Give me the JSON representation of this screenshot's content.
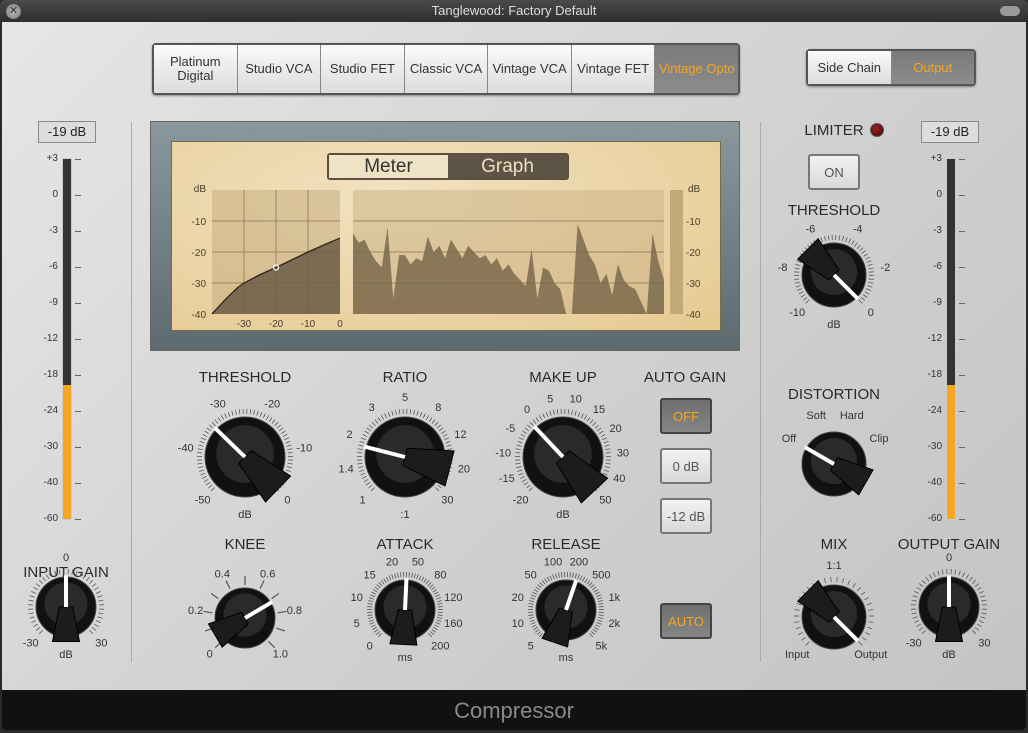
{
  "window": {
    "title": "Tanglewood: Factory Default",
    "close_icon": "close-icon",
    "footer_title": "Compressor"
  },
  "models": {
    "items": [
      {
        "label": "Platinum Digital"
      },
      {
        "label": "Studio VCA"
      },
      {
        "label": "Studio FET"
      },
      {
        "label": "Classic VCA"
      },
      {
        "label": "Vintage VCA"
      },
      {
        "label": "Vintage FET"
      },
      {
        "label": "Vintage Opto",
        "selected": true
      }
    ]
  },
  "routing": {
    "items": [
      {
        "label": "Side Chain"
      },
      {
        "label": "Output",
        "selected": true
      }
    ]
  },
  "colors": {
    "accent": "#f5a623",
    "meter_fill": "#f5a623",
    "display_bg": "#e9d3a3"
  },
  "input_meter": {
    "reading": "-19 dB",
    "scale": [
      "+3",
      "0",
      "-3",
      "-6",
      "-9",
      "-12",
      "-18",
      "-24",
      "-30",
      "-40",
      "-60"
    ],
    "level_fraction": 0.37
  },
  "output_meter": {
    "reading": "-19 dB",
    "scale": [
      "+3",
      "0",
      "-3",
      "-6",
      "-9",
      "-12",
      "-18",
      "-24",
      "-30",
      "-40",
      "-60"
    ],
    "level_fraction": 0.37
  },
  "display": {
    "tabs": [
      {
        "label": "Meter"
      },
      {
        "label": "Graph",
        "selected": true
      }
    ],
    "left_unit": "dB",
    "right_unit": "dB",
    "y_ticks": [
      "-10",
      "-20",
      "-30",
      "-40"
    ],
    "x_ticks": [
      "-40",
      "-30",
      "-20",
      "-10",
      "0"
    ],
    "right_ticks": [
      "-10",
      "-20",
      "-30",
      "-40"
    ]
  },
  "chart_data": [
    {
      "type": "line",
      "title": "",
      "xlabel": "",
      "ylabel": "dB",
      "xlim": [
        -40,
        0
      ],
      "ylim": [
        -40,
        0
      ],
      "x": [
        -40,
        -36,
        -32,
        -30,
        -25,
        -20,
        -15,
        -10,
        -5,
        0
      ],
      "y": [
        -40,
        -35.5,
        -31.5,
        -30,
        -27.3,
        -25,
        -22.5,
        -20,
        -17.7,
        -15.5
      ],
      "marker": {
        "x": -20,
        "y": -25
      },
      "grid": true
    },
    {
      "type": "area",
      "title": "",
      "ylabel": "dB",
      "ylim": [
        -40,
        0
      ],
      "grid": true,
      "values": [
        -14,
        -17,
        -16,
        -20,
        -23,
        -25,
        -12,
        -35,
        -21,
        -21,
        -24,
        -22,
        -23,
        -15,
        -20,
        -18,
        -22,
        -16,
        -19,
        -22,
        -18,
        -20,
        -22,
        -21,
        -24,
        -22,
        -26,
        -24,
        -27,
        -29,
        -31,
        -19,
        -35,
        -25,
        -26,
        -30,
        -32,
        -40,
        -40,
        -11,
        -16,
        -21,
        -24,
        -30,
        -27,
        -34,
        -24,
        -29,
        -31,
        -32,
        -36,
        -40,
        -14,
        -23,
        -29
      ]
    }
  ],
  "knobs": {
    "input_gain": {
      "title": "INPUT GAIN",
      "unit": "dB",
      "labels": [
        "-30",
        "0",
        "30"
      ],
      "position": 0.5
    },
    "threshold": {
      "title": "THRESHOLD",
      "unit": "dB",
      "labels": [
        "-50",
        "-40",
        "-30",
        "-20",
        "-10",
        "0"
      ],
      "position": 0.33
    },
    "ratio": {
      "title": "RATIO",
      "unit": ":1",
      "labels": [
        "1",
        "1.4",
        "2",
        "3",
        "5",
        "8",
        "12",
        "20",
        "30"
      ],
      "position": 0.22
    },
    "makeup": {
      "title": "MAKE UP",
      "unit": "dB",
      "labels": [
        "-20",
        "-15",
        "-10",
        "-5",
        "0",
        "5",
        "10",
        "15",
        "20",
        "30",
        "40",
        "50"
      ],
      "position": 0.34
    },
    "knee": {
      "title": "KNEE",
      "unit": "",
      "labels": [
        "0",
        "0.2",
        "0.4",
        "0.6",
        "0.8",
        "1.0"
      ],
      "position": 0.72
    },
    "attack": {
      "title": "ATTACK",
      "unit": "ms",
      "labels": [
        "0",
        "5",
        "10",
        "15",
        "20",
        "50",
        "80",
        "120",
        "160",
        "200"
      ],
      "position": 0.51
    },
    "release": {
      "title": "RELEASE",
      "unit": "ms",
      "labels": [
        "5",
        "10",
        "20",
        "50",
        "100",
        "200",
        "500",
        "1k",
        "2k",
        "5k"
      ],
      "position": 0.57
    },
    "limiter_threshold": {
      "title": "THRESHOLD",
      "unit": "dB",
      "labels": [
        "-10",
        "-8",
        "-6",
        "-4",
        "-2",
        "0"
      ],
      "position": 1.0
    },
    "distortion": {
      "title": "DISTORTION",
      "unit": "",
      "labels": [
        "Off",
        "Soft",
        "Hard",
        "Clip"
      ],
      "position": 0.0
    },
    "mix": {
      "title": "MIX",
      "unit": "",
      "labels": [
        "Input",
        "1:1",
        "Output"
      ],
      "position": 1.0
    },
    "output_gain": {
      "title": "OUTPUT GAIN",
      "unit": "dB",
      "labels": [
        "-30",
        "0",
        "30"
      ],
      "position": 0.5
    }
  },
  "auto_gain": {
    "title": "AUTO GAIN",
    "buttons": [
      {
        "label": "OFF",
        "selected": true
      },
      {
        "label": "0 dB"
      },
      {
        "label": "-12 dB"
      }
    ],
    "auto_label": "AUTO",
    "auto_selected": true
  },
  "limiter": {
    "title": "LIMITER",
    "on_label": "ON",
    "led_color": "#5a0a0a"
  }
}
